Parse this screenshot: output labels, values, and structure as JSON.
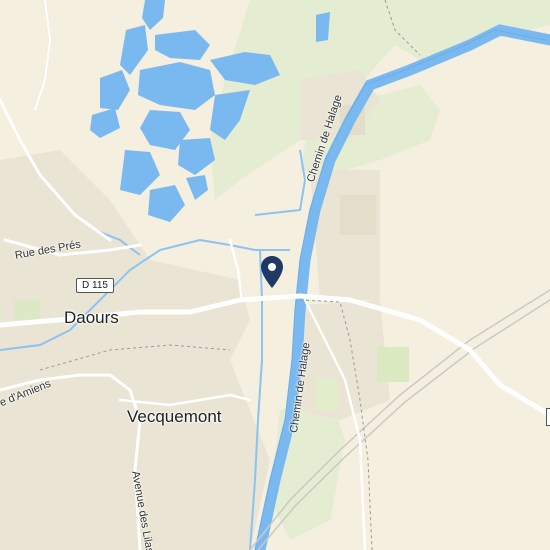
{
  "map": {
    "places": {
      "daours": "Daours",
      "vecquemont": "Vecquemont"
    },
    "roads": {
      "rue_des_pres": "Rue des Prés",
      "route_shield": "D 115",
      "chemin_de_halage_north": "Chemin de Halage",
      "chemin_de_halage_south": "Chemin de Halage",
      "rue_d_amiens": "e d'Amiens",
      "avenue_des_lilas": "Avenue des Lilas"
    },
    "marker": {
      "icon": "map-pin-icon",
      "color": "#1f3864"
    },
    "colors": {
      "background": "#f4efdf",
      "water": "#7ab8f0",
      "water_edge": "#6aaee8",
      "green": "#e2ecd0",
      "built_up": "#ebe6d6",
      "road": "#ffffff",
      "rail": "#cfcfcf"
    }
  }
}
